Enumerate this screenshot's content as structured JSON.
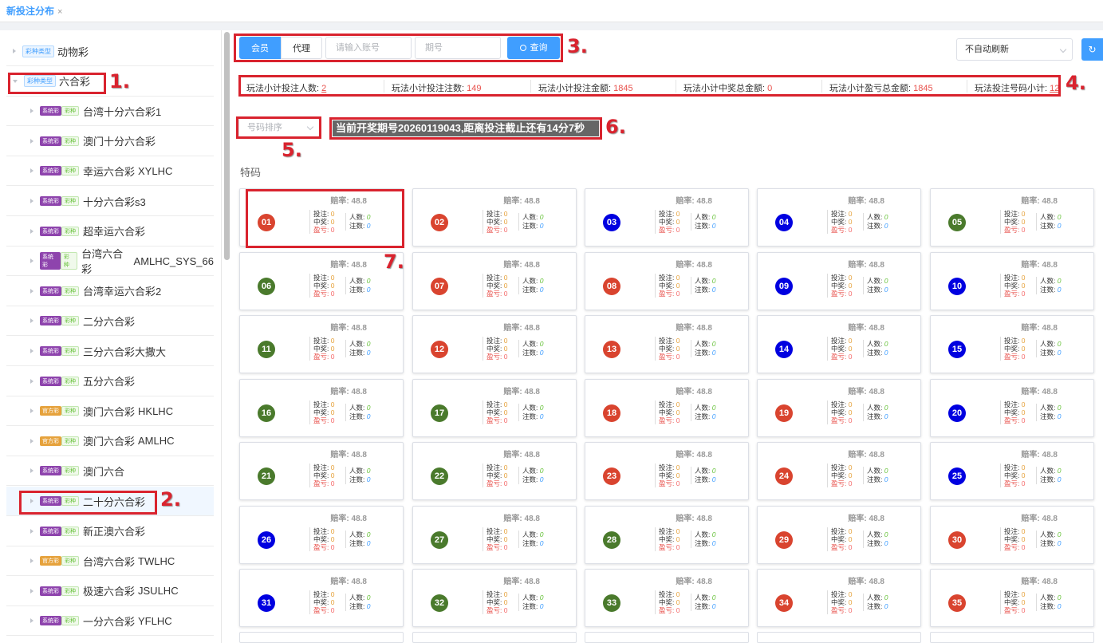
{
  "tab": {
    "title": "新投注分布",
    "close": "×"
  },
  "sidebar": {
    "roots": [
      {
        "badge": "彩种类型",
        "label": "动物彩",
        "expanded": false
      },
      {
        "badge": "彩种类型",
        "label": "六合彩",
        "expanded": true
      }
    ],
    "children": [
      {
        "tag": "系统彩",
        "kind": "彩种",
        "label": "台湾十分六合彩1",
        "code": ""
      },
      {
        "tag": "系统彩",
        "kind": "彩种",
        "label": "澳门十分六合彩",
        "code": ""
      },
      {
        "tag": "系统彩",
        "kind": "彩种",
        "label": "幸运六合彩",
        "code": "XYLHC"
      },
      {
        "tag": "系统彩",
        "kind": "彩种",
        "label": "十分六合彩s3",
        "code": ""
      },
      {
        "tag": "系统彩",
        "kind": "彩种",
        "label": "超幸运六合彩",
        "code": ""
      },
      {
        "tag": "系统彩",
        "kind": "彩种",
        "label": "台湾六合彩",
        "code": "AMLHC_SYS_66"
      },
      {
        "tag": "系统彩",
        "kind": "彩种",
        "label": "台湾幸运六合彩2",
        "code": ""
      },
      {
        "tag": "系统彩",
        "kind": "彩种",
        "label": "二分六合彩",
        "code": ""
      },
      {
        "tag": "系统彩",
        "kind": "彩种",
        "label": "三分六合彩大撒大",
        "code": ""
      },
      {
        "tag": "系统彩",
        "kind": "彩种",
        "label": "五分六合彩",
        "code": ""
      },
      {
        "tag": "官方彩",
        "kind": "彩种",
        "label": "澳门六合彩",
        "code": "HKLHC"
      },
      {
        "tag": "官方彩",
        "kind": "彩种",
        "label": "澳门六合彩",
        "code": "AMLHC"
      },
      {
        "tag": "系统彩",
        "kind": "彩种",
        "label": "澳门六合",
        "code": ""
      },
      {
        "tag": "系统彩",
        "kind": "彩种",
        "label": "二十分六合彩",
        "code": "",
        "selected": true
      },
      {
        "tag": "系统彩",
        "kind": "彩种",
        "label": "新正澳六合彩",
        "code": ""
      },
      {
        "tag": "官方彩",
        "kind": "彩种",
        "label": "台湾六合彩",
        "code": "TWLHC"
      },
      {
        "tag": "系统彩",
        "kind": "彩种",
        "label": "极速六合彩",
        "code": "JSULHC"
      },
      {
        "tag": "系统彩",
        "kind": "彩种",
        "label": "一分六合彩",
        "code": "YFLHC"
      }
    ]
  },
  "toolbar": {
    "member_label": "会员",
    "agent_label": "代理",
    "account_placeholder": "请输入账号",
    "period_placeholder": "期号",
    "query_label": "查询",
    "query_icon": "search-icon",
    "refresh_select": "不自动刷新"
  },
  "stats": [
    {
      "label": "玩法小计投注人数: ",
      "value": "2",
      "style": "u"
    },
    {
      "label": "玩法小计投注注数: ",
      "value": "149",
      "style": "v"
    },
    {
      "label": "玩法小计投注金额: ",
      "value": "1845",
      "style": "v"
    },
    {
      "label": "玩法小计中奖总金额: ",
      "value": "0",
      "style": "v"
    },
    {
      "label": "玩法小计盈亏总金额: ",
      "value": "1845",
      "style": "v"
    },
    {
      "label": "玩法投注号码小计: ",
      "value": "12",
      "style": "u"
    }
  ],
  "sort_select": "号码排序",
  "notice": "当前开奖期号20260119043,距离投注截止还有14分7秒",
  "section_title": "特码",
  "card_labels": {
    "odds": "赔率: ",
    "bet": "投注: ",
    "win": "中奖: ",
    "pl": "盈亏: ",
    "people": "人数: ",
    "count": "注数: "
  },
  "annotations": [
    "1.",
    "2.",
    "3.",
    "4.",
    "5.",
    "6.",
    "7."
  ],
  "colors": {
    "red": "#d9442f",
    "blue": "#0000e0",
    "green": "#4a7a2c",
    "accent": "#409eff",
    "annotation": "#d9232e"
  },
  "numbers": [
    {
      "n": "01",
      "color": "red"
    },
    {
      "n": "02",
      "color": "red"
    },
    {
      "n": "03",
      "color": "blue"
    },
    {
      "n": "04",
      "color": "blue"
    },
    {
      "n": "05",
      "color": "green"
    },
    {
      "n": "06",
      "color": "green"
    },
    {
      "n": "07",
      "color": "red"
    },
    {
      "n": "08",
      "color": "red"
    },
    {
      "n": "09",
      "color": "blue"
    },
    {
      "n": "10",
      "color": "blue"
    },
    {
      "n": "11",
      "color": "green"
    },
    {
      "n": "12",
      "color": "red"
    },
    {
      "n": "13",
      "color": "red"
    },
    {
      "n": "14",
      "color": "blue"
    },
    {
      "n": "15",
      "color": "blue"
    },
    {
      "n": "16",
      "color": "green"
    },
    {
      "n": "17",
      "color": "green"
    },
    {
      "n": "18",
      "color": "red"
    },
    {
      "n": "19",
      "color": "red"
    },
    {
      "n": "20",
      "color": "blue"
    },
    {
      "n": "21",
      "color": "green"
    },
    {
      "n": "22",
      "color": "green"
    },
    {
      "n": "23",
      "color": "red"
    },
    {
      "n": "24",
      "color": "red"
    },
    {
      "n": "25",
      "color": "blue"
    },
    {
      "n": "26",
      "color": "blue"
    },
    {
      "n": "27",
      "color": "green"
    },
    {
      "n": "28",
      "color": "green"
    },
    {
      "n": "29",
      "color": "red"
    },
    {
      "n": "30",
      "color": "red"
    },
    {
      "n": "31",
      "color": "blue"
    },
    {
      "n": "32",
      "color": "green"
    },
    {
      "n": "33",
      "color": "green"
    },
    {
      "n": "34",
      "color": "red"
    },
    {
      "n": "35",
      "color": "red"
    }
  ],
  "card_values": {
    "odds": "48.8",
    "bet": "0",
    "win": "0",
    "pl": "0",
    "people": "0",
    "count": "0"
  }
}
